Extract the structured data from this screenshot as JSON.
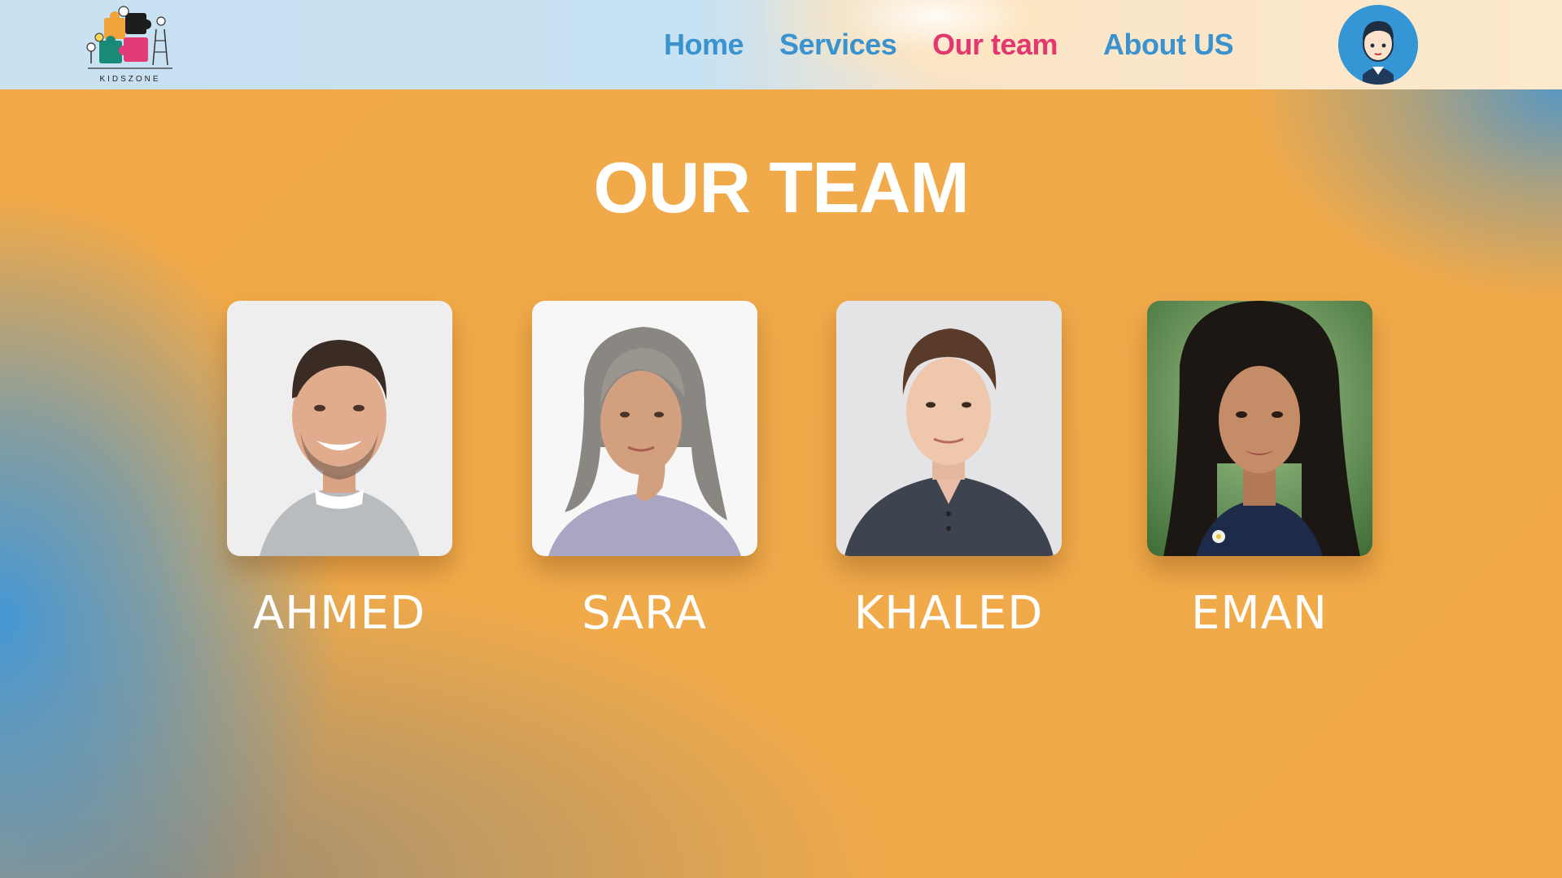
{
  "header": {
    "logo_text": "KIDSZONE",
    "nav": [
      {
        "label": "Home",
        "active": false
      },
      {
        "label": "Services",
        "active": false
      },
      {
        "label": "Our team",
        "active": true
      },
      {
        "label": "About US",
        "active": false
      }
    ],
    "avatar_icon": "boy-avatar-icon"
  },
  "main": {
    "title": "OUR TEAM",
    "members": [
      {
        "name": "AHMED",
        "photo": "man-smiling-gray-sweater-photo"
      },
      {
        "name": "SARA",
        "photo": "gray-haired-woman-thinking-photo"
      },
      {
        "name": "KHALED",
        "photo": "young-man-dark-henley-photo"
      },
      {
        "name": "EMAN",
        "photo": "young-woman-long-dark-hair-photo"
      }
    ]
  },
  "colors": {
    "nav_default": "#3a93cf",
    "nav_active": "#e2376f",
    "background": "#f2a947",
    "avatar_bg": "#3596d6"
  }
}
